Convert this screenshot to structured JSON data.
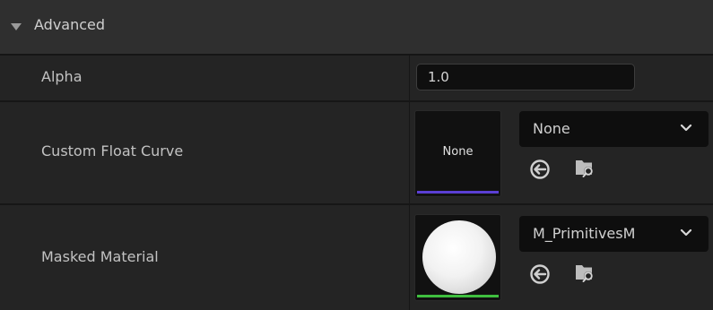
{
  "category": {
    "title": "Advanced"
  },
  "rows": {
    "alpha": {
      "label": "Alpha",
      "value": "1.0"
    },
    "custom_float_curve": {
      "label": "Custom Float Curve",
      "thumbnail_text": "None",
      "combo_value": "None",
      "asset_bar_color": "#5b3fd4"
    },
    "masked_material": {
      "label": "Masked Material",
      "combo_value": "M_PrimitivesM",
      "asset_bar_color": "#3fbf3f"
    }
  },
  "icons": {
    "expand": "triangle-down-icon",
    "chevron": "chevron-down-icon",
    "use_selected": "use-selected-asset-icon",
    "browse": "browse-to-asset-icon"
  },
  "colors": {
    "background": "#151515",
    "header": "#2f2f2f",
    "row": "#242424",
    "input_bg": "#0f0f0f"
  }
}
